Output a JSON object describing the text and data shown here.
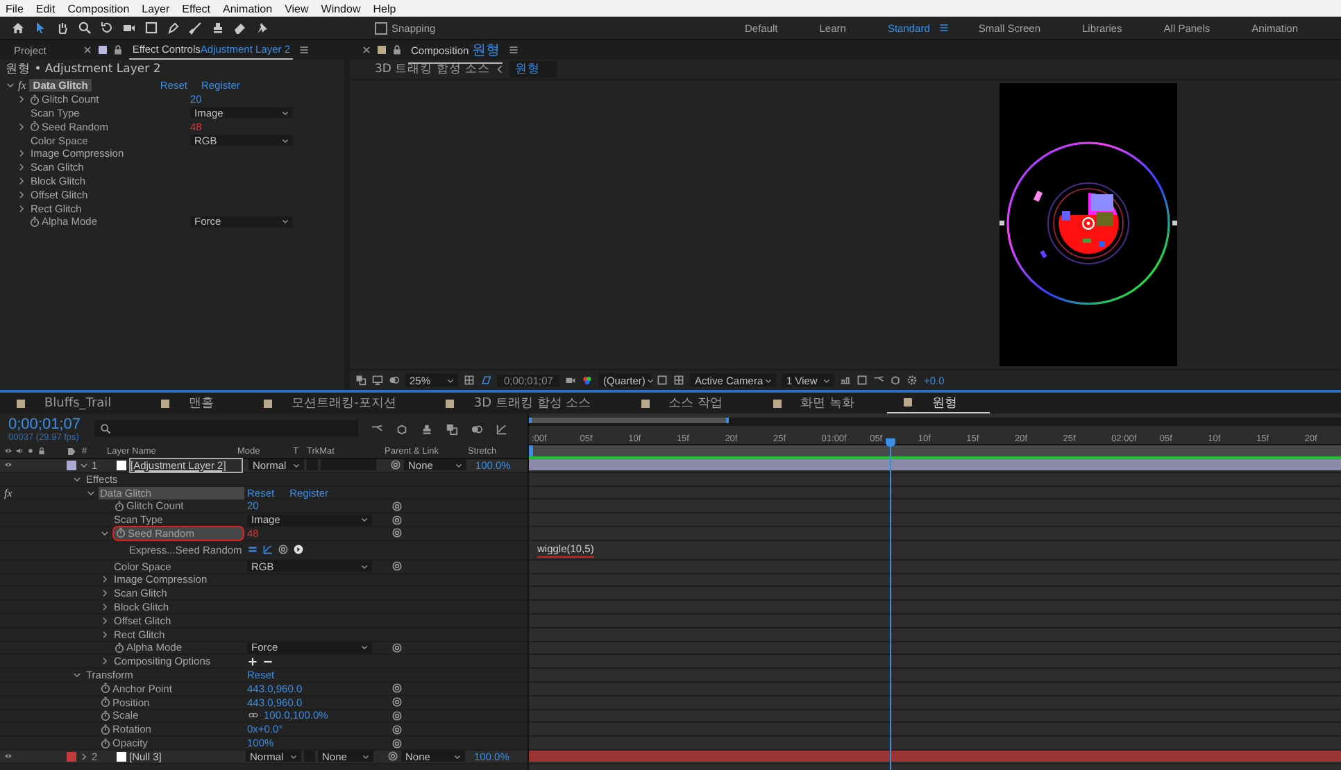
{
  "menu": [
    "File",
    "Edit",
    "Composition",
    "Layer",
    "Effect",
    "Animation",
    "View",
    "Window",
    "Help"
  ],
  "toolbar": {
    "snapping": {
      "label": "Snapping",
      "checked": false
    },
    "workspaces": [
      {
        "label": "Default",
        "selected": false
      },
      {
        "label": "Learn",
        "selected": false
      },
      {
        "label": "Standard",
        "selected": true
      },
      {
        "label": "Small Screen",
        "selected": false
      },
      {
        "label": "Libraries",
        "selected": false
      },
      {
        "label": "All Panels",
        "selected": false
      },
      {
        "label": "Animation",
        "selected": false
      }
    ]
  },
  "effect_controls": {
    "tabs": [
      {
        "label": "Project",
        "selected": false
      },
      {
        "label": "Effect Controls",
        "layer": "Adjustment Layer 2",
        "selected": true
      }
    ],
    "breadcrumb": "원형 • Adjustment Layer 2",
    "effect": {
      "fx": "fx",
      "name": "Data Glitch",
      "expanded": true,
      "selected": true,
      "reset": "Reset",
      "register": "Register"
    },
    "properties": [
      {
        "kind": "number",
        "name": "Glitch Count",
        "value": "20",
        "expanded": false,
        "stopwatch": true
      },
      {
        "kind": "dropdown",
        "name": "Scan Type",
        "value": "Image",
        "stopwatch": false
      },
      {
        "kind": "expr_number",
        "name": "Seed Random",
        "value": "48",
        "expanded": false,
        "stopwatch": true
      },
      {
        "kind": "dropdown",
        "name": "Color Space",
        "value": "RGB",
        "stopwatch": false
      },
      {
        "kind": "group",
        "name": "Image Compression",
        "expanded": false,
        "stopwatch": false
      },
      {
        "kind": "group",
        "name": "Scan Glitch",
        "expanded": false,
        "stopwatch": false
      },
      {
        "kind": "group",
        "name": "Block Glitch",
        "expanded": false,
        "stopwatch": false
      },
      {
        "kind": "group",
        "name": "Offset Glitch",
        "expanded": false,
        "stopwatch": false
      },
      {
        "kind": "group",
        "name": "Rect Glitch",
        "expanded": false,
        "stopwatch": false
      },
      {
        "kind": "dropdown",
        "name": "Alpha Mode",
        "value": "Force",
        "stopwatch": true
      }
    ]
  },
  "composition": {
    "tab": {
      "label": "Composition",
      "name": "원형"
    },
    "breadcrumb": [
      {
        "label": "3D 트래킹 합성 소스",
        "selected": false
      },
      {
        "label": "원형",
        "selected": true
      }
    ],
    "viewer_toolbar": {
      "zoom": "25%",
      "timecode": "0;00;01;07",
      "resolution": "(Quarter)",
      "camera": "Active Camera",
      "views": "1 View",
      "exposure": "+0.0"
    }
  },
  "timeline": {
    "tabs": [
      {
        "label": "Bluffs_Trail",
        "selected": false
      },
      {
        "label": "맨홀",
        "selected": false
      },
      {
        "label": "모션트래킹-포지션",
        "selected": false
      },
      {
        "label": "3D 트래킹 합성 소스",
        "selected": false
      },
      {
        "label": "소스 작업",
        "selected": false
      },
      {
        "label": "화면 녹화",
        "selected": false
      },
      {
        "label": "원형",
        "selected": true
      }
    ],
    "timecode": "0;00;01;07",
    "frame_info": "00037 (29.97 fps)",
    "columns": {
      "number": "#",
      "layer_name": "Layer Name",
      "mode": "Mode",
      "t": "T",
      "trkmat": "TrkMat",
      "parent": "Parent & Link",
      "stretch": "Stretch"
    },
    "ruler": [
      ":00f",
      "05f",
      "10f",
      "15f",
      "20f",
      "25f",
      "01:00f",
      "05f",
      "10f",
      "15f",
      "20f",
      "25f",
      "02:00f",
      "05f",
      "10f",
      "15f",
      "20f"
    ],
    "playhead": {
      "level": 0.444
    },
    "layers": [
      {
        "kind": "layer",
        "number": "1",
        "name": "[Adjustment Layer 2]",
        "color": "#a9a9d6",
        "selected": true,
        "expanded": true,
        "mode": "Normal",
        "parent": "None",
        "stretch": "100.0%",
        "children": [
          {
            "kind": "group",
            "name": "Effects",
            "expanded": true,
            "selected": false,
            "children": [
              {
                "kind": "effect",
                "fx": "fx",
                "name": "Data Glitch",
                "expanded": true,
                "selected": true,
                "reset": "Reset",
                "register": "Register",
                "children": [
                  {
                    "kind": "number",
                    "name": "Glitch Count",
                    "value": "20",
                    "stopwatch": true,
                    "selected": false
                  },
                  {
                    "kind": "dropdown",
                    "name": "Scan Type",
                    "value": "Image",
                    "stopwatch": false,
                    "selected": false
                  },
                  {
                    "kind": "expr_number",
                    "name": "Seed Random",
                    "value": "48",
                    "stopwatch": true,
                    "expanded": true,
                    "selected": true,
                    "circled": true,
                    "children": [
                      {
                        "kind": "expression",
                        "name": "Express...Seed Random",
                        "expression": "wiggle(10,5)",
                        "underlined": true,
                        "selected": false
                      }
                    ]
                  },
                  {
                    "kind": "dropdown",
                    "name": "Color Space",
                    "value": "RGB",
                    "stopwatch": false,
                    "selected": false
                  },
                  {
                    "kind": "group",
                    "name": "Image Compression",
                    "expanded": false,
                    "selected": false
                  },
                  {
                    "kind": "group",
                    "name": "Scan Glitch",
                    "expanded": false,
                    "selected": false
                  },
                  {
                    "kind": "group",
                    "name": "Block Glitch",
                    "expanded": false,
                    "selected": false
                  },
                  {
                    "kind": "group",
                    "name": "Offset Glitch",
                    "expanded": false,
                    "selected": false
                  },
                  {
                    "kind": "group",
                    "name": "Rect Glitch",
                    "expanded": false,
                    "selected": false
                  },
                  {
                    "kind": "dropdown",
                    "name": "Alpha Mode",
                    "value": "Force",
                    "stopwatch": true,
                    "selected": false
                  },
                  {
                    "kind": "group",
                    "name": "Compositing Options",
                    "expanded": false,
                    "selected": false,
                    "add_remove": true
                  }
                ]
              }
            ]
          },
          {
            "kind": "group",
            "name": "Transform",
            "expanded": true,
            "selected": false,
            "reset": "Reset",
            "children": [
              {
                "kind": "number",
                "name": "Anchor Point",
                "value": "443.0,960.0",
                "stopwatch": true,
                "selected": false
              },
              {
                "kind": "number",
                "name": "Position",
                "value": "443.0,960.0",
                "stopwatch": true,
                "selected": false
              },
              {
                "kind": "number",
                "name": "Scale",
                "value": "100.0,100.0%",
                "stopwatch": true,
                "linked": true,
                "selected": false
              },
              {
                "kind": "number",
                "name": "Rotation",
                "value": "0x+0.0°",
                "stopwatch": true,
                "selected": false
              },
              {
                "kind": "number",
                "name": "Opacity",
                "value": "100%",
                "stopwatch": true,
                "selected": false
              }
            ]
          }
        ]
      },
      {
        "kind": "layer",
        "number": "2",
        "name": "[Null 3]",
        "color": "#c23a3a",
        "selected": false,
        "expanded": false,
        "mode": "Normal",
        "trkmat": "None",
        "parent": "None",
        "stretch": "100.0%"
      }
    ]
  }
}
